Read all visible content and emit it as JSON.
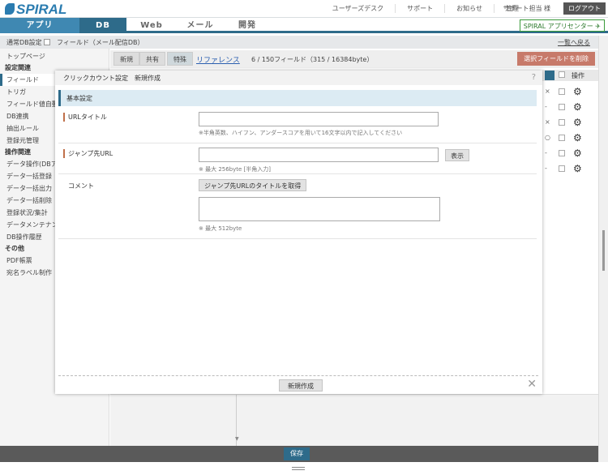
{
  "header": {
    "logo": "SPIRAL",
    "links": [
      "ユーザーズデスク",
      "サポート",
      "お知らせ",
      "管理"
    ],
    "user": "サポート担当 様",
    "logout": "ログアウト"
  },
  "nav": {
    "tabs": [
      "アプリ",
      "DB",
      "Web",
      "メール",
      "開発"
    ],
    "app_center": "SPIRAL アプリセンター"
  },
  "subbar": {
    "db_setting": "通常DB設定",
    "breadcrumb": "フィールド（メール配信DB）",
    "back_link": "一覧へ戻る"
  },
  "sidebar": {
    "top": "トップページ",
    "sections": [
      {
        "title": "設定関連",
        "items": [
          "フィールド",
          "トリガ",
          "フィールド値自動",
          "DB連携",
          "抽出ルール",
          "登録元管理"
        ]
      },
      {
        "title": "操作関連",
        "items": [
          "データ操作(DBア",
          "データ一括登録",
          "データ一括出力",
          "データ一括削除",
          "登録状況/集計",
          "データメンテナン",
          "DB操作履歴"
        ]
      },
      {
        "title": "その他",
        "items": [
          "PDF帳票",
          "宛名ラベル制作"
        ]
      }
    ]
  },
  "toolbar": {
    "buttons": [
      "新規",
      "共有",
      "特殊"
    ],
    "reference_link": "リファレンス",
    "field_info": "6 / 150フィールド（315 / 16384byte）",
    "delete_button": "選択フィールドを削除"
  },
  "table_right": {
    "header_label": "操作",
    "marks": [
      "×",
      "-",
      "×",
      "○",
      "-",
      "-"
    ]
  },
  "modal": {
    "title": "クリックカウント設定　新規作成",
    "help": "?",
    "section_title": "基本設定",
    "url_title": {
      "label": "URLタイトル",
      "value": "",
      "hint": "※半角英数、ハイフン、アンダースコアを用いて16文字以内で記入してください"
    },
    "jump_url": {
      "label": "ジャンプ先URL",
      "value": "",
      "show_button": "表示",
      "hint": "※ 最大 256byte [半角入力]"
    },
    "comment": {
      "label": "コメント",
      "fetch_button": "ジャンプ先URLのタイトルを取得",
      "value": "",
      "hint": "※ 最大 512byte"
    },
    "create_button": "新規作成",
    "close": "✕"
  },
  "footer": {
    "save_button": "保存"
  }
}
